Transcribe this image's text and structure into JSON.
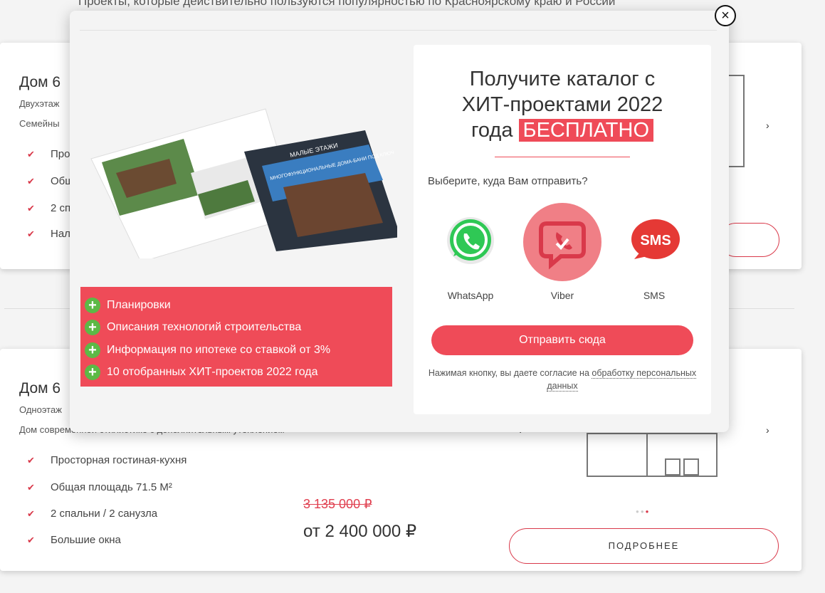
{
  "background": {
    "tagline": "Проекты, которые действительно пользуются популярностью по Красноярскому краю и России",
    "card1": {
      "title": "Дом 6",
      "subtitle1": "Двухэтаж",
      "subtitle2": "Семейны",
      "features": [
        "Прос",
        "Общ",
        "2 сп",
        "Нал"
      ]
    },
    "card2": {
      "title": "Дом 6",
      "subtitle1": "Одноэтаж",
      "subtitle2": "Дом современной стилистике с дополнительным утеплением",
      "features": [
        "Просторная гостиная-кухня",
        "Общая площадь 71.5 М²",
        "2 спальни / 2 санузла",
        "Большие окна"
      ],
      "old_price": "3 135 000 ₽",
      "new_price": "от 2 400 000 ₽",
      "more_label": "ПОДРОБНЕЕ"
    }
  },
  "modal": {
    "close_glyph": "×",
    "catalog_cover_brand": "МАЛЫЕ ЭТАЖИ",
    "catalog_cover_title": "МНОГОФУНКЦИОНАЛЬНЫЕ ДОМА-БАНИ ПОД КЛЮЧ",
    "benefits": [
      "Планировки",
      "Описания технологий строительства",
      "Информация по ипотеке со ставкой от 3%",
      "10 отобранных ХИТ-проектов 2022 года"
    ],
    "title_line1": "Получите каталог с",
    "title_line2": "ХИТ-проектами 2022",
    "title_line3": "года",
    "title_badge": "БЕСПЛАТНО",
    "choose_prompt": "Выберите, куда Вам отправить?",
    "messengers": [
      {
        "label": "WhatsApp",
        "icon": "whatsapp-icon",
        "color": "#25d366"
      },
      {
        "label": "Viber",
        "icon": "viber-icon",
        "color": "#d9394a",
        "selected": true
      },
      {
        "label": "SMS",
        "icon": "sms-icon",
        "color": "#e53935"
      }
    ],
    "send_label": "Отправить сюда",
    "consent_text": "Нажимая кнопку, вы даете согласие на",
    "consent_link": "обработку персональных данных"
  },
  "colors": {
    "accent": "#ef4b58",
    "green": "#5cb946"
  }
}
